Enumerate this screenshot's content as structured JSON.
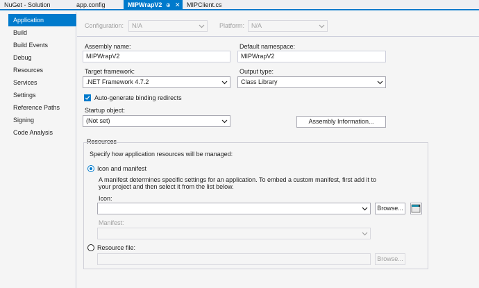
{
  "tabs": [
    {
      "label": "NuGet - Solution"
    },
    {
      "label": "app.config"
    },
    {
      "label": "MIPWrapV2",
      "pin": "⊕",
      "close": "✕"
    },
    {
      "label": "MIPClient.cs"
    }
  ],
  "sidebar": {
    "items": [
      {
        "label": "Application"
      },
      {
        "label": "Build"
      },
      {
        "label": "Build Events"
      },
      {
        "label": "Debug"
      },
      {
        "label": "Resources"
      },
      {
        "label": "Services"
      },
      {
        "label": "Settings"
      },
      {
        "label": "Reference Paths"
      },
      {
        "label": "Signing"
      },
      {
        "label": "Code Analysis"
      }
    ]
  },
  "config": {
    "configuration_label": "Configuration:",
    "configuration_value": "N/A",
    "platform_label": "Platform:",
    "platform_value": "N/A"
  },
  "app": {
    "assembly_name_label": "Assembly name:",
    "assembly_name_value": "MIPWrapV2",
    "default_namespace_label": "Default namespace:",
    "default_namespace_value": "MIPWrapV2",
    "target_framework_label": "Target framework:",
    "target_framework_value": ".NET Framework 4.7.2",
    "output_type_label": "Output type:",
    "output_type_value": "Class Library",
    "binding_redirects_label": "Auto-generate binding redirects",
    "startup_object_label": "Startup object:",
    "startup_object_value": "(Not set)",
    "assembly_info_button": "Assembly Information..."
  },
  "resources": {
    "group_title": "Resources",
    "description": "Specify how application resources will be managed:",
    "icon_manifest_label": "Icon and manifest",
    "manifest_help_line1": "A manifest determines specific settings for an application. To embed a custom manifest, first add it to",
    "manifest_help_line2": "your project and then select it from the list below.",
    "icon_label": "Icon:",
    "icon_value": "",
    "browse_button": "Browse...",
    "manifest_label": "Manifest:",
    "manifest_value": "",
    "resource_file_label": "Resource file:",
    "resource_file_value": "",
    "browse_button_2": "Browse..."
  },
  "colors": {
    "accent": "#007acc",
    "background": "#f5f5f5",
    "text": "#1e1e1e",
    "disabled_text": "#a0a0a0"
  }
}
